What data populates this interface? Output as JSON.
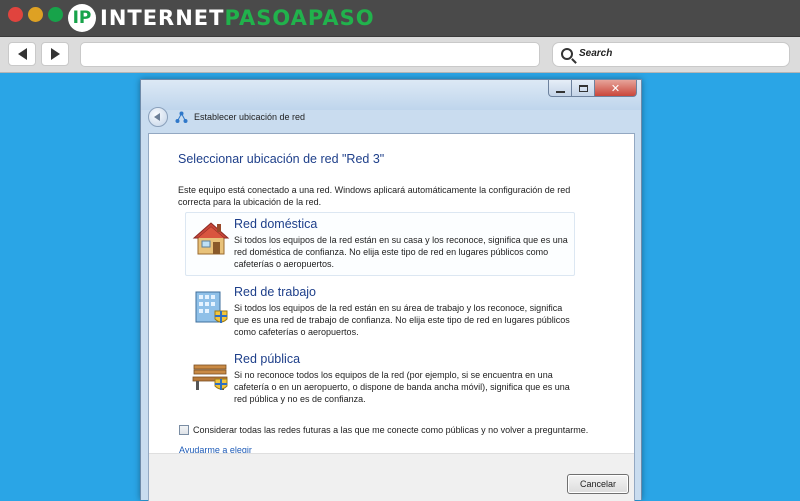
{
  "browser": {
    "logo": {
      "text_part1": "INTERNET",
      "text_part2": "PASOAPASO",
      "badge": "IP"
    },
    "search": {
      "placeholder": "Search",
      "icon": "search-icon"
    },
    "nav": {
      "back_icon": "back-arrow-icon",
      "forward_icon": "forward-arrow-icon"
    },
    "traffic_lights": [
      "#e0443e",
      "#dea123",
      "#17a34a"
    ]
  },
  "window": {
    "title": "Establecer ubicación de red",
    "controls": {
      "minimize_icon": "minimize-icon",
      "maximize_icon": "maximize-icon",
      "close_label": "✕"
    },
    "heading": "Seleccionar ubicación de red \"Red  3\"",
    "intro": "Este equipo está conectado a una red. Windows aplicará automáticamente la configuración de red correcta para la ubicación de la red.",
    "options": [
      {
        "title": "Red doméstica",
        "description": "Si todos los equipos de la red están en su casa y los reconoce, significa que es una red doméstica de confianza. No elija este tipo de red en lugares públicos como cafeterías o aeropuertos.",
        "icon": "house-icon"
      },
      {
        "title": "Red de trabajo",
        "description": "Si todos los equipos de la red están en su área de trabajo y los reconoce, significa que es una red de trabajo de confianza. No elija este tipo de red en lugares públicos como cafeterías o aeropuertos.",
        "icon": "office-building-icon"
      },
      {
        "title": "Red pública",
        "description": "Si no reconoce todos los equipos de la red (por ejemplo, si se encuentra en una cafetería o en un aeropuerto, o dispone de banda ancha móvil), significa que es una red pública y no es de confianza.",
        "icon": "park-bench-icon"
      }
    ],
    "checkbox_label": "Considerar todas las redes futuras a las que me conecte como públicas y no volver a preguntarme.",
    "checkbox_checked": false,
    "help_link": "Ayudarme a elegir",
    "cancel_button": "Cancelar"
  },
  "colors": {
    "desktop": "#2aa5e6",
    "heading": "#1e3f8a",
    "link": "#1e5bb7"
  }
}
